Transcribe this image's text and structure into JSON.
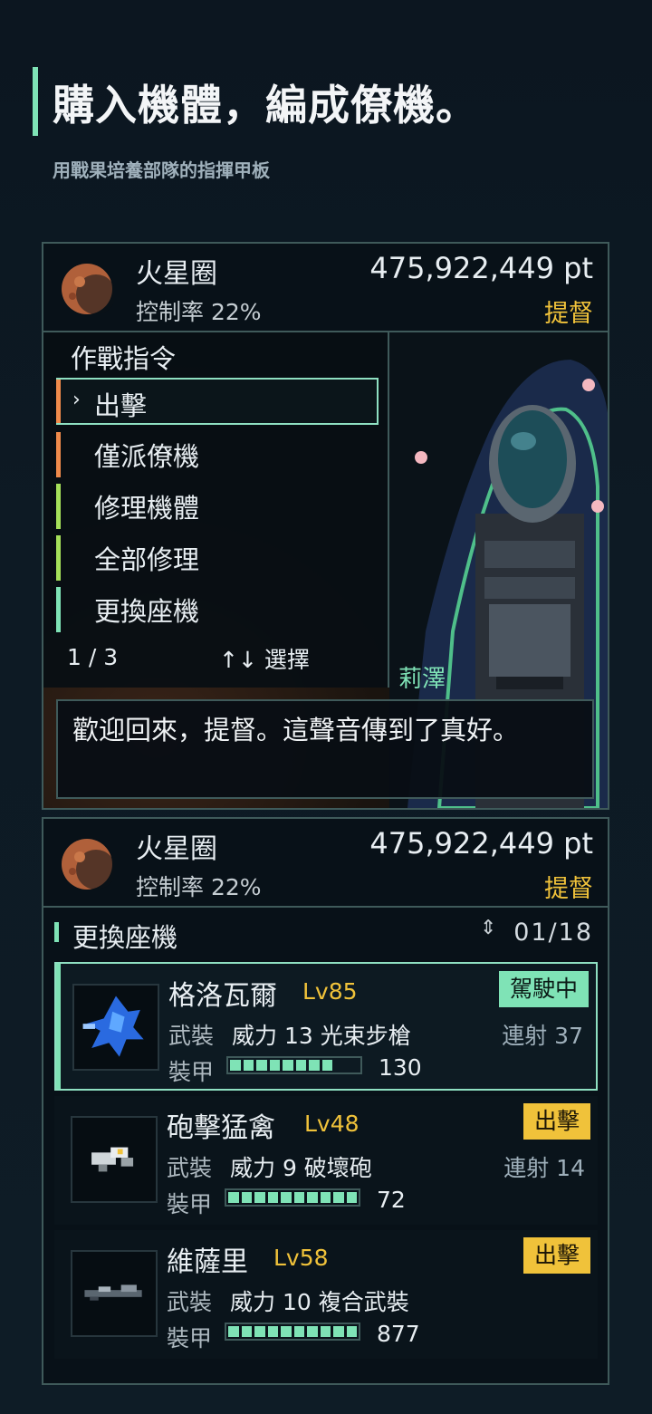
{
  "hero": {
    "title": "購入機體，編成僚機。",
    "subtitle": "用戰果培養部隊的指揮甲板"
  },
  "panel1": {
    "location": "火星圈",
    "control_rate": "控制率 22%",
    "points": "475,922,449 pt",
    "rank": "提督",
    "menu": {
      "title": "作戰指令",
      "items": [
        {
          "label": "出擊",
          "selected": true,
          "color": "#f08a4b"
        },
        {
          "label": "僅派僚機",
          "selected": false,
          "color": "#f08a4b"
        },
        {
          "label": "修理機體",
          "selected": false,
          "color": "#a6e05a"
        },
        {
          "label": "全部修理",
          "selected": false,
          "color": "#a6e05a"
        },
        {
          "label": "更換座機",
          "selected": false,
          "color": "#7fe3b6"
        }
      ],
      "page": "1 / 3",
      "hint": "↑↓ 選擇"
    },
    "character_name": "莉澤",
    "dialog": "歡迎回來，提督。這聲音傳到了真好。"
  },
  "panel2": {
    "location": "火星圈",
    "control_rate": "控制率 22%",
    "points": "475,922,449 pt",
    "rank": "提督",
    "list_title": "更換座機",
    "count": "01/18",
    "units": [
      {
        "name": "格洛瓦爾",
        "level": "Lv85",
        "badge": "駕駛中",
        "weapon_label": "武裝",
        "weapon": "威力 13  光束步槍",
        "rapid": "連射 37",
        "armor_label": "裝甲",
        "armor": "130",
        "armor_fill": 0.8,
        "active": true
      },
      {
        "name": "砲擊猛禽",
        "level": "Lv48",
        "badge": "出擊",
        "weapon_label": "武裝",
        "weapon": "威力 9  破壞砲",
        "rapid": "連射 14",
        "armor_label": "裝甲",
        "armor": "72",
        "armor_fill": 1.0,
        "active": false
      },
      {
        "name": "維薩里",
        "level": "Lv58",
        "badge": "出擊",
        "weapon_label": "武裝",
        "weapon": "威力 10  複合武裝",
        "rapid": "",
        "armor_label": "裝甲",
        "armor": "877",
        "armor_fill": 1.0,
        "active": false
      }
    ]
  },
  "colors": {
    "accent": "#7fe3b6",
    "gold": "#f0c23a",
    "border": "#3f5a5a"
  },
  "icons": {
    "planet": "mars-planet-icon",
    "chevron": "chevron-right-icon",
    "sort": "sort-updown-icon"
  }
}
